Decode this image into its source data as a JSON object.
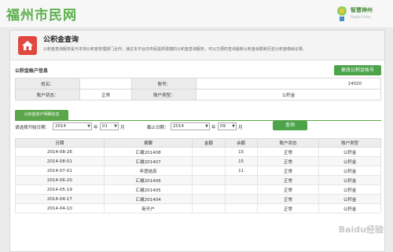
{
  "site": {
    "logo": "福州市民网",
    "brand_name": "智慧神州",
    "brand_sub": "Digital China"
  },
  "hero": {
    "title": "公积金查询",
    "desc": "公积金查询服务是与本地公积金管理部门合作，通过本平台向市民提供便捷的公积金查询服务，可以方便的查询最新公积金余额和历史公积金缴纳记录。",
    "icon": "house-icon"
  },
  "account": {
    "section_title": "公积金账户信息",
    "change_button": "更改公积金帐号",
    "rows": [
      [
        {
          "label": "姓名：",
          "value": ""
        },
        {
          "label": "账号：",
          "value": "14020"
        }
      ],
      [
        {
          "label": "账户状态：",
          "value": "正常"
        },
        {
          "label": "账户类型：",
          "value": "公积金"
        }
      ]
    ]
  },
  "details": {
    "tab_label": "公积金账户明细信息",
    "start_label": "请选择开始日期：",
    "end_label": "截止日期：",
    "start_year": "2014",
    "start_month": "01",
    "end_year": "2014",
    "end_month": "09",
    "year_unit": "年",
    "month_unit": "月",
    "search_button": "查询"
  },
  "table": {
    "headers": [
      "日期",
      "摘要",
      "金额",
      "余额",
      "账户状态",
      "账户类型"
    ],
    "rows": [
      [
        "2014-08-26",
        "汇缴201408",
        "",
        "15",
        "正常",
        "公积金"
      ],
      [
        "2014-08-01",
        "汇缴201407",
        "",
        "15",
        "正常",
        "公积金"
      ],
      [
        "2014-07-01",
        "年度结息",
        "",
        "11",
        "正常",
        "公积金"
      ],
      [
        "2014-06-20",
        "汇缴201406",
        "",
        "",
        "正常",
        "公积金"
      ],
      [
        "2014-05-19",
        "汇缴201405",
        "",
        "",
        "正常",
        "公积金"
      ],
      [
        "2014-04-17",
        "汇缴201404",
        "",
        "",
        "正常",
        "公积金"
      ],
      [
        "2014-04-10",
        "新开户",
        "",
        "",
        "正常",
        "公积金"
      ]
    ]
  },
  "watermark": "Baidu经验",
  "colors": {
    "accent": "#4ba34a",
    "logo": "#5cb04c",
    "hero_icon": "#e0473e"
  }
}
